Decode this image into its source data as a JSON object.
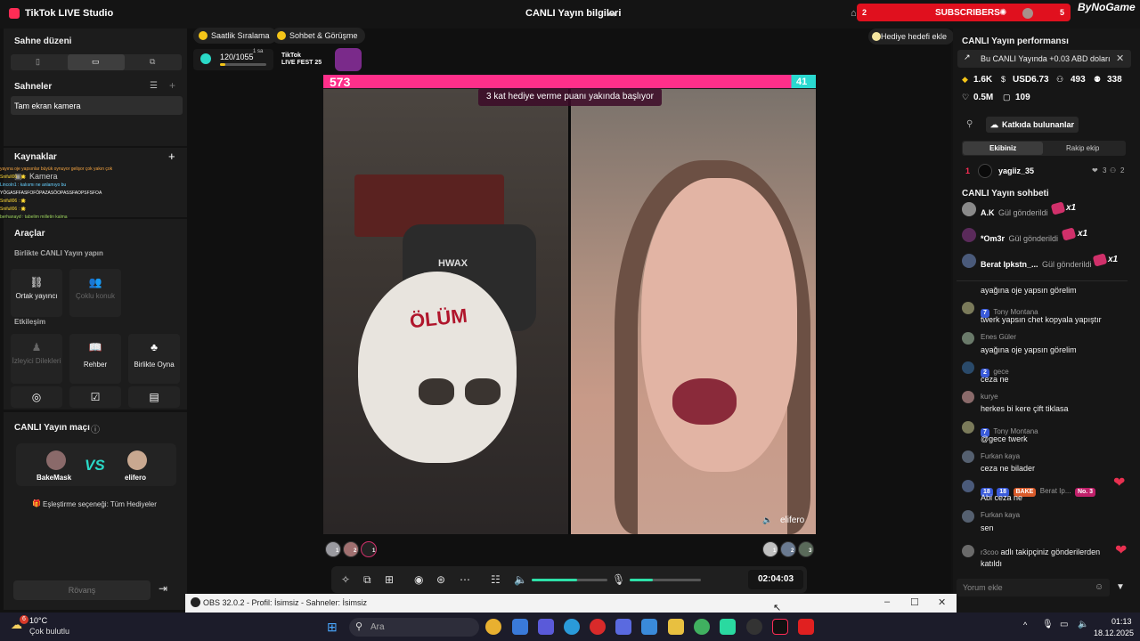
{
  "app": {
    "title": "TikTok LIVE Studio",
    "live_info_label": "CANLI Yayın bilgileri",
    "subscribers_label": "SUBSCRIBERS",
    "subscribers_left": "2",
    "subscribers_right": "5",
    "brand_watermark": "ByNoGame"
  },
  "left": {
    "scene_layout_title": "Sahne düzeni",
    "scenes_title": "Sahneler",
    "scene_item": "Tam ekran kamera",
    "sources_title": "Kaynaklar",
    "source_item": "Kamera",
    "tools_title": "Araçlar",
    "collab_title": "Birlikte CANLI Yayın yapın",
    "tools_collab": [
      {
        "label": "Ortak yayıncı",
        "icon": "link-icon"
      },
      {
        "label": "Çoklu konuk",
        "icon": "users-icon"
      }
    ],
    "interaction_title": "Etkileşim",
    "tools_interaction": [
      {
        "label": "İzleyici Dilekleri",
        "icon": "wish-icon"
      },
      {
        "label": "Rehber",
        "icon": "book-icon"
      },
      {
        "label": "Birlikte Oyna",
        "icon": "play-together-icon"
      }
    ],
    "overlay_chat": [
      "yayına oje yapsınlar büyük oynuyor gelişor çok yakın çok",
      "Snifull06 : 🌟",
      "Lincoln1 : kalısmı ne anlamıyo bu",
      "YÖGASFFASFOFÖPAZASÖOPASSFAOPSFSFOA",
      "Snifull06 : 🌟",
      "Snifull06 : 🌟",
      "berhanayd : tabelim milletin kalma"
    ],
    "match_title": "CANLI Yayın maçı",
    "match_left_name": "BakeMask",
    "match_right_name": "elifero",
    "match_vs": "VS",
    "match_option": "Eşleştirme seçeneği: Tüm Hediyeler",
    "rematch_label": "Rövanş"
  },
  "center": {
    "chips": [
      "Saatlik Sıralama",
      "Sohbet & Görüşme"
    ],
    "gift_goal_chip": "Hediye hedefi ekle",
    "gift_progress": "120/1055",
    "gift_progress_fraction": 0.114,
    "gift_timer": "1 sa",
    "fest_line1": "TikTok",
    "fest_line2": "LIVE FEST 25",
    "score_left": "573",
    "score_right": "41",
    "notice": "3 kat hediye verme puanı yakında başlıyor",
    "streamer_chair_text": "HWAX",
    "streamer_mask_text": "ÖLÜM",
    "right_name": "elifero",
    "left_top_viewers": [
      "1",
      "2",
      "1"
    ],
    "right_top_viewers": [
      "1",
      "2",
      "3"
    ],
    "timer": "02:04:03",
    "volume_level": 0.6,
    "mic_level": 0.32
  },
  "right": {
    "perf_title": "CANLI Yayın performansı",
    "perf_banner": "Bu CANLI Yayında +0.03 ABD doları",
    "stats": [
      {
        "icon": "diamond-icon",
        "value": "1.6K"
      },
      {
        "icon": "dollar-icon",
        "value": "USD6.73"
      },
      {
        "icon": "viewers-icon",
        "value": "493"
      },
      {
        "icon": "followers-icon",
        "value": "338"
      },
      {
        "icon": "likes-icon",
        "value": "0.5M"
      },
      {
        "icon": "comments-icon",
        "value": "109"
      }
    ],
    "contributors_label": "Katkıda bulunanlar",
    "team_tab_own": "Ekibiniz",
    "team_tab_rival": "Rakip ekip",
    "top_rank": "1",
    "top_user": "yagiiz_35",
    "top_likes": "3",
    "top_people": "2",
    "chat_title": "CANLI Yayın sohbeti",
    "gift_rows": [
      {
        "name": "A.K",
        "action": "Gül gönderildi",
        "count": "x1"
      },
      {
        "name": "*Om3r",
        "action": "Gül gönderildi",
        "count": "x1"
      },
      {
        "name": "Berat Ipkstn_...",
        "action": "Gül gönderildi",
        "count": "x1"
      }
    ],
    "chat": [
      {
        "name": "",
        "level": "",
        "msg": "ayağına oje yapsın görelim"
      },
      {
        "name": "Tony Montana",
        "level": "7",
        "msg": "twerk yapsın chet kopyala yapıştır"
      },
      {
        "name": "Enes Güler",
        "level": "",
        "msg": "ayağına oje yapsın görelim"
      },
      {
        "name": "gece",
        "level": "2",
        "msg": "ceza ne"
      },
      {
        "name": "kurye",
        "level": "",
        "msg": "herkes bi kere çift tiklasa"
      },
      {
        "name": "Tony Montana",
        "level": "7",
        "msg": "@gece twerk"
      },
      {
        "name": "Furkan kaya",
        "level": "",
        "msg": "ceza ne bilader"
      },
      {
        "name": "Berat Ip...",
        "level": "18",
        "msg": "Abi ceza ne",
        "badges": [
          "18",
          "BAKE",
          "No. 3"
        ]
      },
      {
        "name": "Furkan kaya",
        "level": "",
        "msg": "sen"
      }
    ],
    "follow_note_user": "r3coo",
    "follow_note": "adlı takipçiniz gönderilerden katıldı",
    "comment_placeholder": "Yorum ekle"
  },
  "obs": {
    "title": "OBS 32.0.2 - Profil: İsimsiz - Sahneler: İsimsiz"
  },
  "taskbar": {
    "weather_badge": "6",
    "temp": "10°C",
    "weather": "Çok bulutlu",
    "search_placeholder": "Ara",
    "time": "01:13",
    "date": "18.12.2025"
  }
}
